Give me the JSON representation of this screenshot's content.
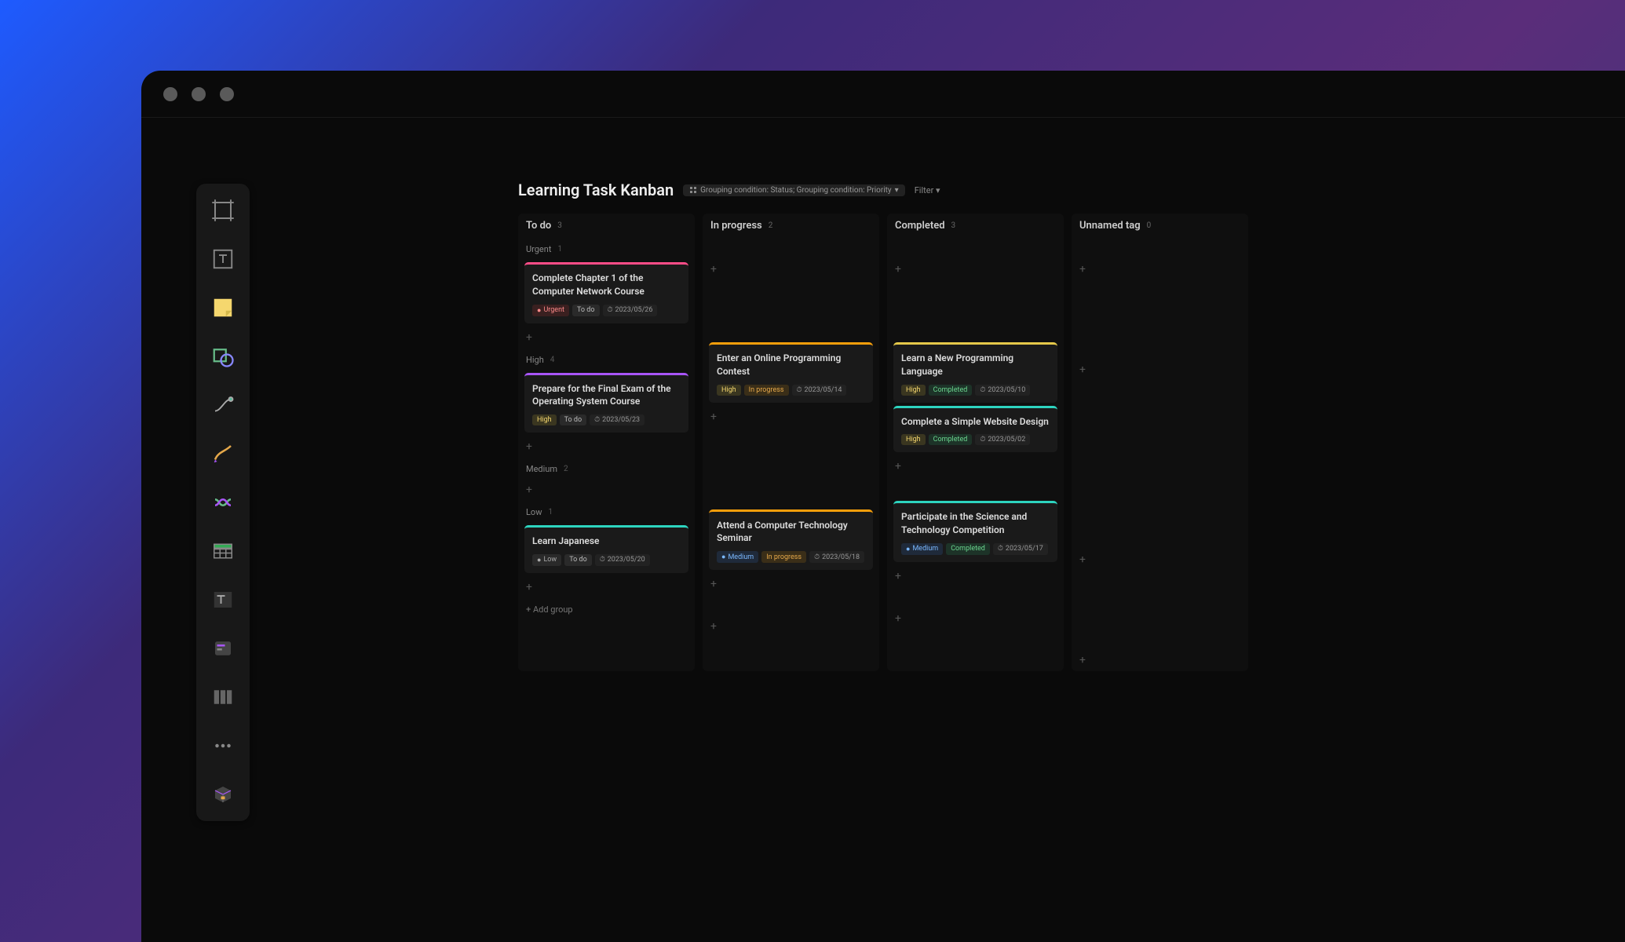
{
  "board": {
    "title": "Learning Task Kanban",
    "grouping_label": "Grouping condition: Status; Grouping condition: Priority",
    "filter_label": "Filter",
    "add_group_label": "+ Add group",
    "columns": [
      {
        "name": "To do",
        "count": 3
      },
      {
        "name": "In progress",
        "count": 2
      },
      {
        "name": "Completed",
        "count": 3
      },
      {
        "name": "Unnamed tag",
        "count": 0
      }
    ],
    "priority_groups": [
      {
        "name": "Urgent",
        "count": 1
      },
      {
        "name": "High",
        "count": 4
      },
      {
        "name": "Medium",
        "count": 2
      },
      {
        "name": "Low",
        "count": 1
      }
    ],
    "cards": {
      "urgent_todo": {
        "title": "Complete Chapter 1 of the Computer Network Course",
        "priority": "Urgent",
        "status": "To do",
        "date": "2023/05/26"
      },
      "high_todo": {
        "title": "Prepare for the Final Exam of the Operating System Course",
        "priority": "High",
        "status": "To do",
        "date": "2023/05/23"
      },
      "high_prog": {
        "title": "Enter an Online Programming Contest",
        "priority": "High",
        "status": "In progress",
        "date": "2023/05/14"
      },
      "high_comp1": {
        "title": "Learn a New Programming Language",
        "priority": "High",
        "status": "Completed",
        "date": "2023/05/10"
      },
      "high_comp2": {
        "title": "Complete a Simple Website Design",
        "priority": "High",
        "status": "Completed",
        "date": "2023/05/02"
      },
      "med_prog": {
        "title": "Attend a Computer Technology Seminar",
        "priority": "Medium",
        "status": "In progress",
        "date": "2023/05/18"
      },
      "med_comp": {
        "title": "Participate in the Science and Technology Competition",
        "priority": "Medium",
        "status": "Completed",
        "date": "2023/05/17"
      },
      "low_todo": {
        "title": "Learn Japanese",
        "priority": "Low",
        "status": "To do",
        "date": "2023/05/20"
      }
    }
  },
  "toolbar": {
    "tools": [
      "frame",
      "text",
      "sticky-note",
      "shape",
      "connector",
      "brush",
      "swap",
      "table",
      "text-block",
      "card",
      "columns",
      "more",
      "box"
    ]
  }
}
